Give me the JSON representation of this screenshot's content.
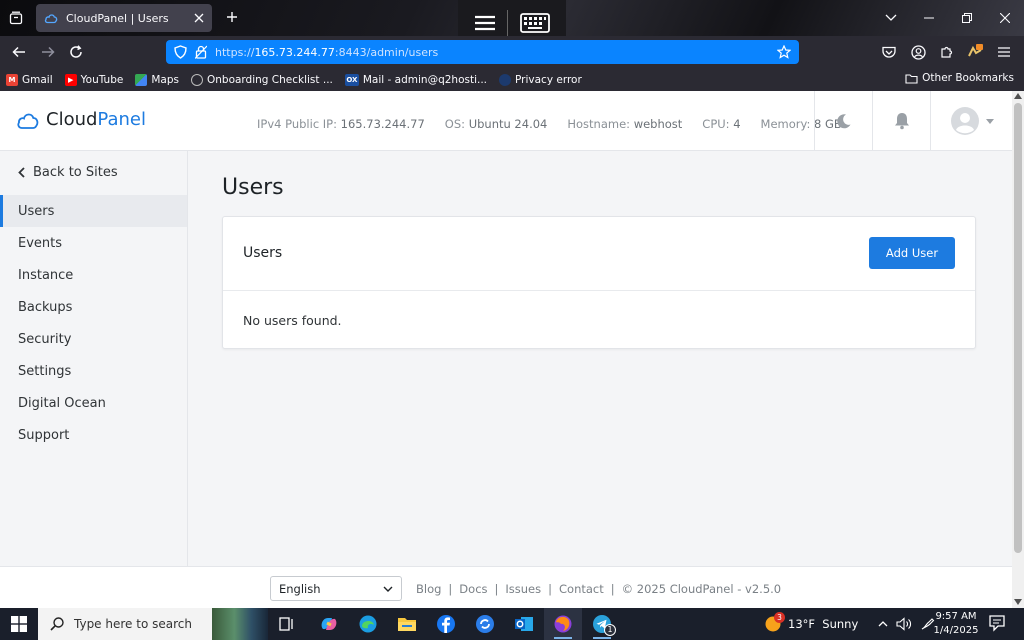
{
  "browser": {
    "tab_title": "CloudPanel | Users",
    "url_prefix": "https://",
    "url_host": "165.73.244.77",
    "url_rest": ":8443/admin/users",
    "bookmarks": [
      {
        "label": "Gmail",
        "color": "#ea4335"
      },
      {
        "label": "YouTube",
        "color": "#ff0000"
      },
      {
        "label": "Maps",
        "color": "#34a853"
      },
      {
        "label": "Onboarding Checklist ...",
        "color": "#888888"
      },
      {
        "label": "Mail - admin@q2hosti...",
        "color": "#1a4fa0"
      },
      {
        "label": "Privacy error",
        "color": "#1c3a6e"
      }
    ],
    "other_bookmarks": "Other Bookmarks"
  },
  "app": {
    "logo_cloud": "Cloud",
    "logo_panel": "Panel",
    "sysinfo": {
      "ip_label": "IPv4 Public IP:",
      "ip_value": "165.73.244.77",
      "os_label": "OS:",
      "os_value": "Ubuntu 24.04",
      "host_label": "Hostname:",
      "host_value": "webhost",
      "cpu_label": "CPU:",
      "cpu_value": "4",
      "mem_label": "Memory:",
      "mem_value": "8 GB"
    },
    "sidebar": {
      "back_label": "Back to Sites",
      "items": [
        "Users",
        "Events",
        "Instance",
        "Backups",
        "Security",
        "Settings",
        "Digital Ocean",
        "Support"
      ],
      "active_index": 0
    },
    "page_title": "Users",
    "card": {
      "title": "Users",
      "add_button": "Add User",
      "empty_message": "No users found."
    },
    "footer": {
      "language": "English",
      "links": [
        "Blog",
        "Docs",
        "Issues",
        "Contact"
      ],
      "copyright": "© 2025  CloudPanel  - v2.5.0"
    },
    "accent_color": "#1d7be0"
  },
  "taskbar": {
    "search_placeholder": "Type here to search",
    "weather": "13°F  Sunny",
    "weather_badge": "3",
    "time": "9:57 AM",
    "date": "1/4/2025",
    "telegram_badge": "1"
  }
}
